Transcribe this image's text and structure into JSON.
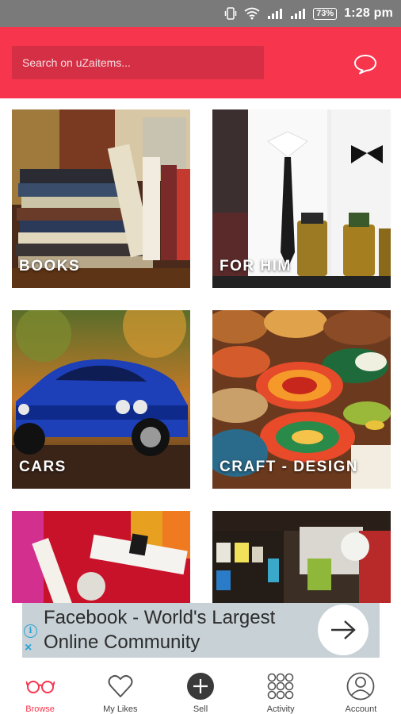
{
  "status_bar": {
    "battery": "73%",
    "time": "1:28 pm"
  },
  "header": {
    "search_placeholder": "Search on uZaitems..."
  },
  "categories": [
    {
      "label": "BOOKS"
    },
    {
      "label": "FOR HIM"
    },
    {
      "label": "CARS"
    },
    {
      "label": "CRAFT - DESIGN"
    },
    {
      "label": ""
    },
    {
      "label": ""
    }
  ],
  "ad": {
    "text": "Facebook - World's Largest Online Community",
    "info_glyph": "i",
    "close_glyph": "×"
  },
  "nav": [
    {
      "label": "Browse",
      "icon": "glasses-icon",
      "active": true
    },
    {
      "label": "My Likes",
      "icon": "heart-icon",
      "active": false
    },
    {
      "label": "Sell",
      "icon": "plus-circle-icon",
      "active": false
    },
    {
      "label": "Activity",
      "icon": "dots-grid-icon",
      "active": false
    },
    {
      "label": "Account",
      "icon": "user-icon",
      "active": false
    }
  ],
  "colors": {
    "brand": "#f7364e",
    "status_bar": "#7a7a7a",
    "ad_background": "#c7d1d6"
  }
}
